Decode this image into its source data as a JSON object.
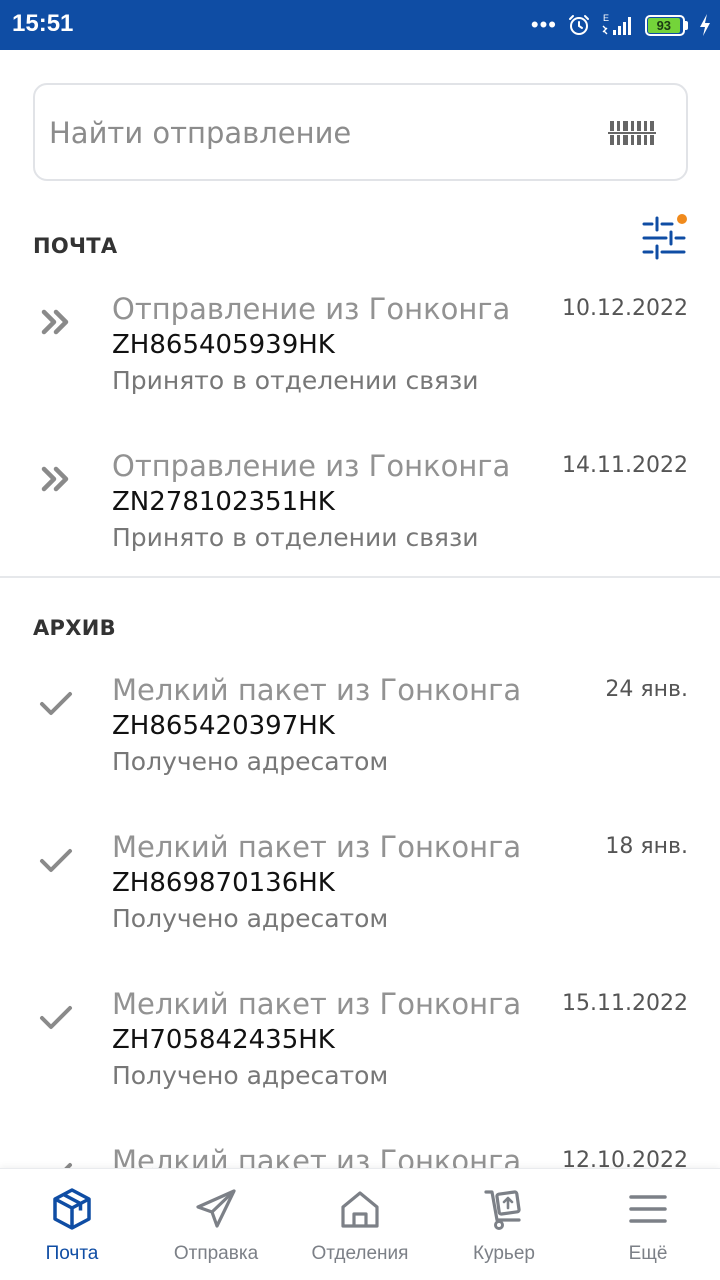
{
  "status_bar": {
    "time": "15:51",
    "dots": "•••",
    "battery_level": "93",
    "network_label": "E",
    "color": "#0f4da4"
  },
  "search": {
    "placeholder": "Найти отправление",
    "icon": "barcode-scan-icon"
  },
  "sections": {
    "active": {
      "title": "ПОЧТА",
      "items": [
        {
          "title": "Отправление из Гонконга",
          "code": "ZH865405939HK",
          "status": "Принято в отделении связи",
          "date": "10.12.2022",
          "icon": "double-chevron-icon"
        },
        {
          "title": "Отправление из Гонконга",
          "code": "ZN278102351HK",
          "status": "Принято в отделении связи",
          "date": "14.11.2022",
          "icon": "double-chevron-icon"
        }
      ]
    },
    "archive": {
      "title": "АРХИВ",
      "items": [
        {
          "title": "Мелкий пакет из Гонконга",
          "code": "ZH865420397HK",
          "status": "Получено адресатом",
          "date": "24 янв.",
          "icon": "checkmark-icon"
        },
        {
          "title": "Мелкий пакет из Гонконга",
          "code": "ZH869870136HK",
          "status": "Получено адресатом",
          "date": "18 янв.",
          "icon": "checkmark-icon"
        },
        {
          "title": "Мелкий пакет из Гонконга",
          "code": "ZH705842435HK",
          "status": "Получено адресатом",
          "date": "15.11.2022",
          "icon": "checkmark-icon"
        },
        {
          "title": "Мелкий пакет из Гонконга",
          "code": "",
          "status": "",
          "date": "12.10.2022",
          "icon": "checkmark-icon"
        }
      ]
    }
  },
  "filter": {
    "icon": "filter-sliders-icon",
    "has_badge": true,
    "badge_color": "#f08a1c"
  },
  "nav": {
    "items": [
      {
        "label": "Почта",
        "icon": "parcel-box-icon",
        "active": true
      },
      {
        "label": "Отправка",
        "icon": "paper-plane-icon",
        "active": false
      },
      {
        "label": "Отделения",
        "icon": "house-icon",
        "active": false
      },
      {
        "label": "Курьер",
        "icon": "hand-truck-icon",
        "active": false
      },
      {
        "label": "Ещё",
        "icon": "menu-icon",
        "active": false
      }
    ]
  },
  "colors": {
    "accent": "#0f4da4",
    "text_muted": "#929292"
  }
}
